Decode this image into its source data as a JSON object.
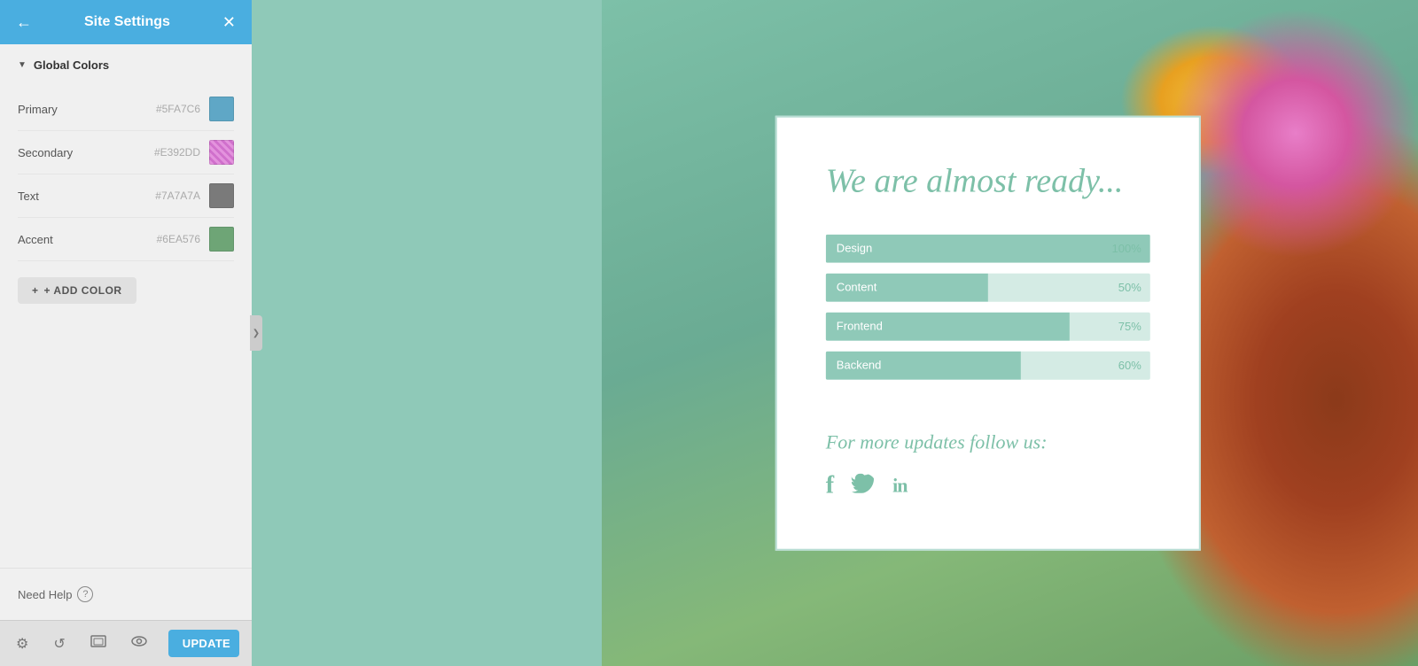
{
  "sidebar": {
    "header": {
      "title": "Site Settings",
      "back_label": "←",
      "close_label": "✕"
    },
    "global_colors": {
      "section_label": "Global Colors",
      "colors": [
        {
          "name": "Primary",
          "hex": "#5FA7C6",
          "value": "#5FA7C6"
        },
        {
          "name": "Secondary",
          "hex": "#E392DD",
          "value": "#E392DD"
        },
        {
          "name": "Text",
          "hex": "#7A7A7A",
          "value": "#7A7A7A"
        },
        {
          "name": "Accent",
          "hex": "#6EA576",
          "value": "#6EA576"
        }
      ]
    },
    "add_color_label": "+ ADD COLOR",
    "help_label": "Need Help",
    "collapse_icon": "❯"
  },
  "footer": {
    "settings_icon": "⚙",
    "history_icon": "↺",
    "responsive_icon": "▭",
    "preview_icon": "👁",
    "update_label": "UPDATE",
    "dropdown_icon": "▾"
  },
  "canvas": {
    "card": {
      "title": "We are almost ready...",
      "progress_items": [
        {
          "label": "Design",
          "pct": 100,
          "pct_label": "100%"
        },
        {
          "label": "Content",
          "pct": 50,
          "pct_label": "50%"
        },
        {
          "label": "Frontend",
          "pct": 75,
          "pct_label": "75%"
        },
        {
          "label": "Backend",
          "pct": 60,
          "pct_label": "60%"
        }
      ],
      "follow_text": "For more updates follow us:",
      "social_icons": [
        "f",
        "🐦",
        "in"
      ]
    }
  }
}
